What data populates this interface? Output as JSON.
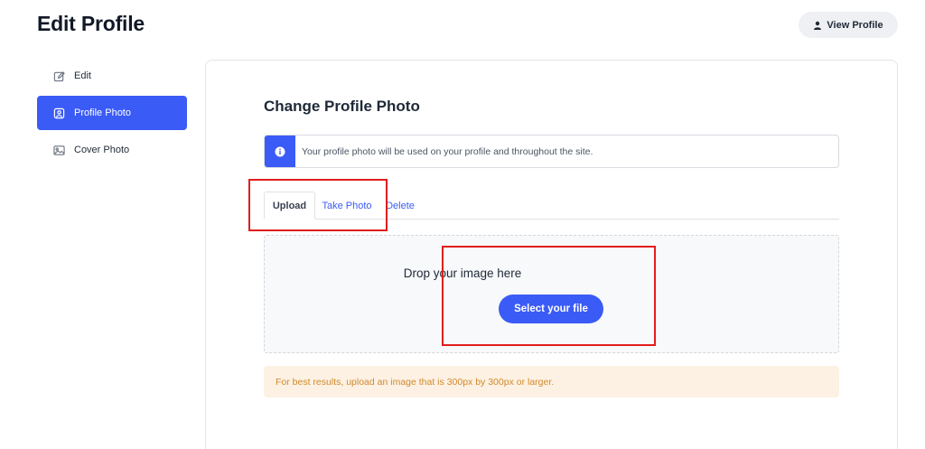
{
  "header": {
    "title": "Edit Profile",
    "view_profile_label": "View Profile"
  },
  "sidebar": {
    "items": [
      {
        "label": "Edit",
        "icon": "edit-icon",
        "active": false
      },
      {
        "label": "Profile Photo",
        "icon": "profile-photo-icon",
        "active": true
      },
      {
        "label": "Cover Photo",
        "icon": "image-icon",
        "active": false
      }
    ]
  },
  "main": {
    "section_title": "Change Profile Photo",
    "info_text": "Your profile photo will be used on your profile and throughout the site.",
    "tabs": [
      {
        "label": "Upload",
        "active": true
      },
      {
        "label": "Take Photo",
        "active": false
      },
      {
        "label": "Delete",
        "active": false
      }
    ],
    "dropzone": {
      "text": "Drop your image here",
      "button_label": "Select your file"
    },
    "tip_text": "For best results, upload an image that is 300px by 300px or larger."
  },
  "colors": {
    "accent": "#3b5bf6",
    "highlight": "#e11d1d",
    "tip_background": "#fdf1e3",
    "tip_text": "#d08a2c"
  }
}
